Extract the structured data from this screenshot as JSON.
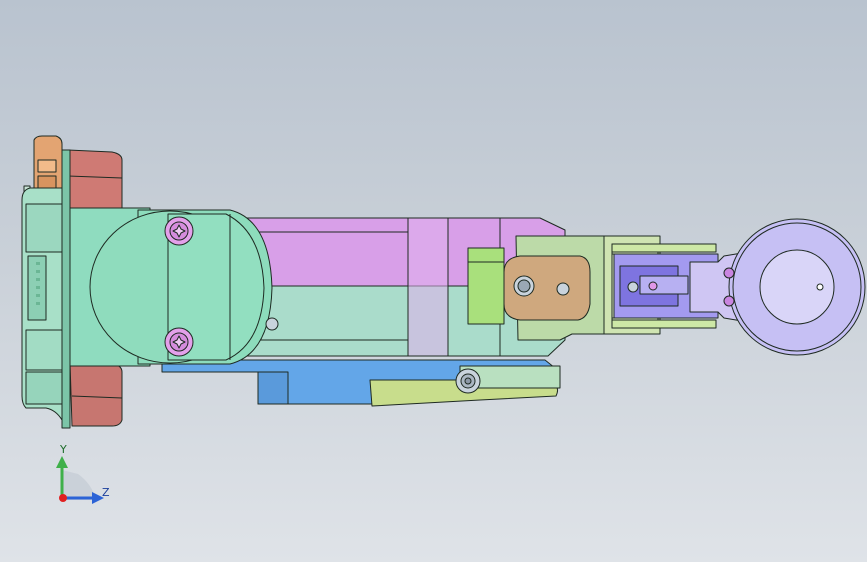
{
  "viewport": {
    "background_top": "#b9c3cf",
    "background_bottom": "#dfe3e8"
  },
  "model": {
    "part_colors": {
      "base_housing": "#8fd9bd",
      "flange_ring": "#cf7a74",
      "connector_orange": "#e0a070",
      "upper_arm_top": "#d69ee6",
      "upper_arm_bottom": "#a9dccb",
      "lower_plate_blue": "#62a4e6",
      "lower_plate_green": "#c7dc8a",
      "forearm_sage": "#b8d9a6",
      "wrist_purple": "#9a8cf0",
      "end_flange_lavender": "#c3bdf0",
      "bracket_green": "#a6e07a",
      "screw_pink": "#e098e8",
      "outline": "#1e2a22"
    }
  },
  "triad": {
    "y_label": "Y",
    "z_label": "Z",
    "y_color": "#3fb04a",
    "z_color": "#2b63d6",
    "x_color": "#e02020"
  }
}
